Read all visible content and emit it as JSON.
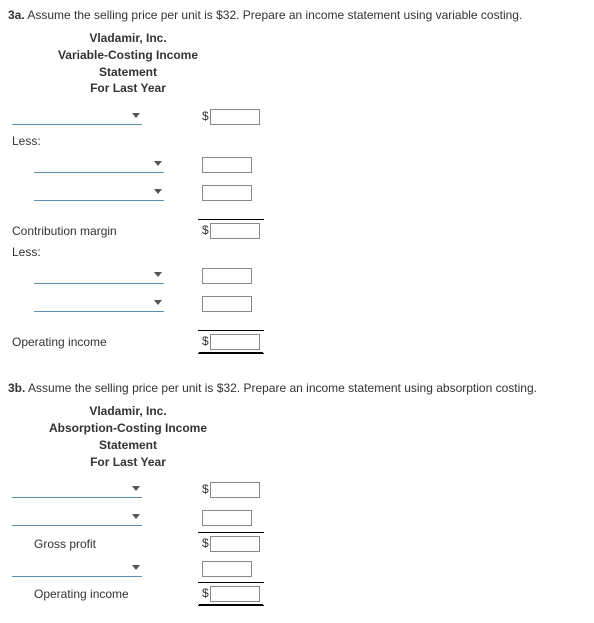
{
  "q3a": {
    "num": "3a.",
    "prompt": "Assume the selling price per unit is $32. Prepare an income statement using variable costing.",
    "title": {
      "company": "Vladamir, Inc.",
      "type": "Variable-Costing Income",
      "word": "Statement",
      "period": "For Last Year"
    },
    "labels": {
      "less1": "Less:",
      "contrib": "Contribution margin",
      "less2": "Less:",
      "opinc": "Operating income"
    }
  },
  "q3b": {
    "num": "3b.",
    "prompt": "Assume the selling price per unit is $32. Prepare an income statement using absorption costing.",
    "title": {
      "company": "Vladamir, Inc.",
      "type": "Absorption-Costing Income",
      "word": "Statement",
      "period": "For Last Year"
    },
    "labels": {
      "gross": "Gross profit",
      "opinc": "Operating income"
    }
  }
}
